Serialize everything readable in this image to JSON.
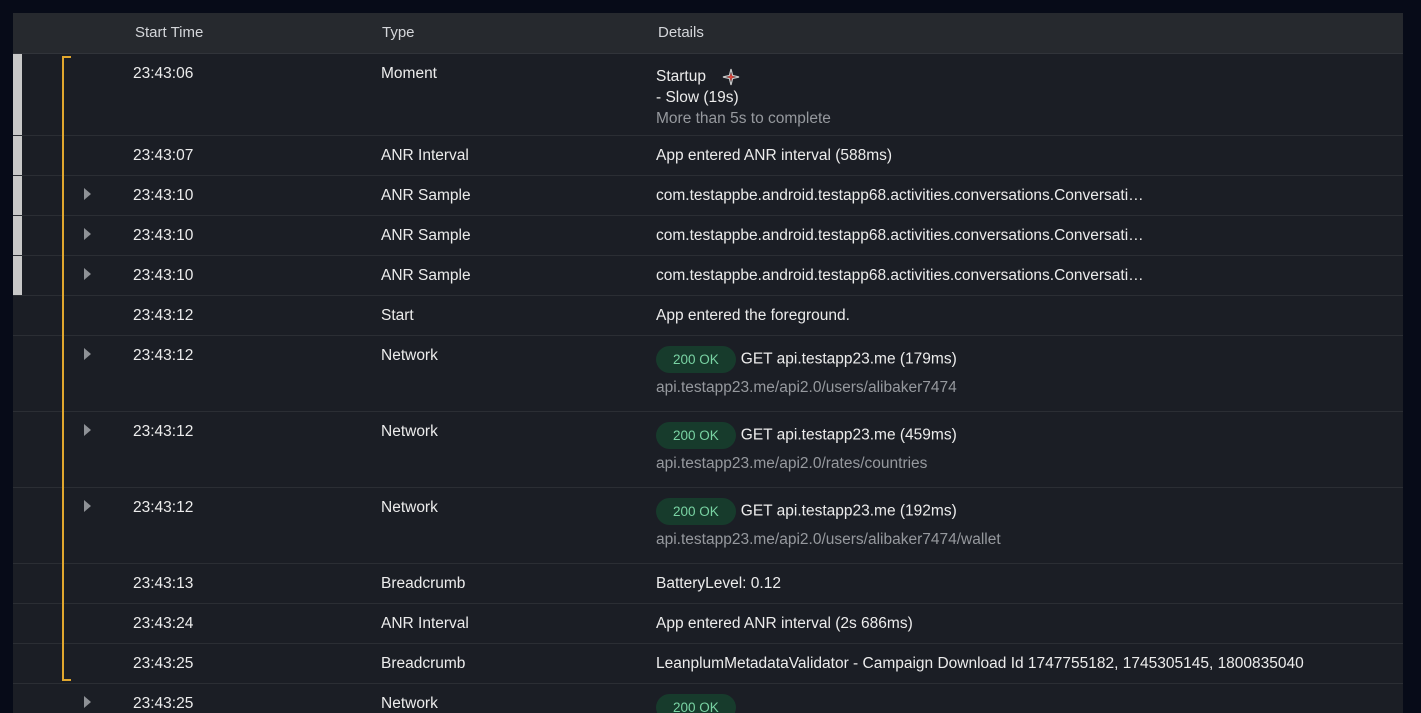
{
  "header": {
    "start_time": "Start Time",
    "type": "Type",
    "details": "Details"
  },
  "rows": [
    {
      "time": "23:43:06",
      "type": "Moment",
      "details": "Startup",
      "details_line2": "- Slow (19s)",
      "details_sub": "More than 5s to complete",
      "icon": "startup-spark-icon"
    },
    {
      "time": "23:43:07",
      "type": "ANR Interval",
      "details": "App entered ANR interval (588ms)"
    },
    {
      "time": "23:43:10",
      "type": "ANR Sample",
      "details": "com.testappbe.android.testapp68.activities.conversations.Conversati…"
    },
    {
      "time": "23:43:10",
      "type": "ANR Sample",
      "details": "com.testappbe.android.testapp68.activities.conversations.Conversati…"
    },
    {
      "time": "23:43:10",
      "type": "ANR Sample",
      "details": "com.testappbe.android.testapp68.activities.conversations.Conversati…"
    },
    {
      "time": "23:43:12",
      "type": "Start",
      "details": "App entered the foreground."
    },
    {
      "time": "23:43:12",
      "type": "Network",
      "status": "200 OK",
      "details": "GET api.testapp23.me (179ms)",
      "details_sub": "api.testapp23.me/api2.0/users/alibaker7474"
    },
    {
      "time": "23:43:12",
      "type": "Network",
      "status": "200 OK",
      "details": "GET api.testapp23.me (459ms)",
      "details_sub": "api.testapp23.me/api2.0/rates/countries"
    },
    {
      "time": "23:43:12",
      "type": "Network",
      "status": "200 OK",
      "details": "GET api.testapp23.me (192ms)",
      "details_sub": "api.testapp23.me/api2.0/users/alibaker7474/wallet"
    },
    {
      "time": "23:43:13",
      "type": "Breadcrumb",
      "details": "BatteryLevel: 0.12"
    },
    {
      "time": "23:43:24",
      "type": "ANR Interval",
      "details": "App entered ANR interval (2s 686ms)"
    },
    {
      "time": "23:43:25",
      "type": "Breadcrumb",
      "details": "LeanplumMetadataValidator - Campaign Download Id 1747755182, 1745305145, 1800835040"
    },
    {
      "time": "23:43:25",
      "type": "Network",
      "status": "200 OK",
      "details": "",
      "details_sub": ""
    }
  ],
  "colors": {
    "background": "#070b18",
    "panel": "#1b1e25",
    "header": "#26292e",
    "bracket": "#e1a72e",
    "badge_bg": "#173b2c",
    "badge_text": "#79d3a3",
    "selection_bar": "#c8c8c8"
  }
}
